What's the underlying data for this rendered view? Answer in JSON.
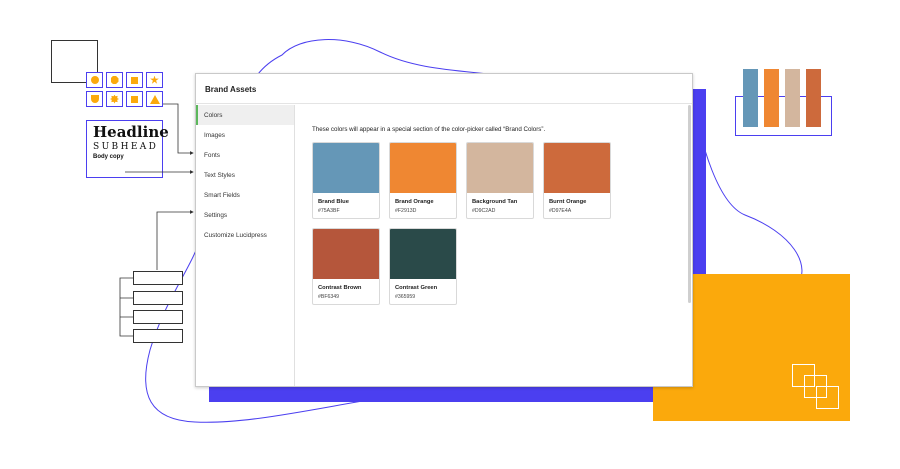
{
  "window": {
    "title": "Brand Assets"
  },
  "sidebar": {
    "items": [
      {
        "label": "Colors",
        "active": true
      },
      {
        "label": "Images",
        "active": false
      },
      {
        "label": "Fonts",
        "active": false
      },
      {
        "label": "Text Styles",
        "active": false
      },
      {
        "label": "Smart Fields",
        "active": false
      },
      {
        "label": "Settings",
        "active": false
      },
      {
        "label": "Customize Lucidpress",
        "active": false
      }
    ]
  },
  "content": {
    "note": "These colors will appear in a special section of the color-picker called “Brand Colors”.",
    "colors": [
      {
        "name": "Brand Blue",
        "hex": "#75A3BF",
        "color": "#6597b7"
      },
      {
        "name": "Brand Orange",
        "hex": "#F2913D",
        "color": "#ef8732"
      },
      {
        "name": "Background Tan",
        "hex": "#D9C2AD",
        "color": "#d3b69e"
      },
      {
        "name": "Burnt Orange",
        "hex": "#D97E4A",
        "color": "#cd6a3c"
      },
      {
        "name": "Contrast Brown",
        "hex": "#BF6349",
        "color": "#b5563b"
      },
      {
        "name": "Contrast Green",
        "hex": "#365959",
        "color": "#2a4a49"
      }
    ]
  },
  "decor": {
    "headline": "Headline",
    "subhead": "SUBHEAD",
    "body": "Body copy",
    "swatch_colors": [
      "#6597b7",
      "#ef8732",
      "#d3b69e",
      "#cd6a3c"
    ],
    "accent": "#4b3ff0",
    "highlight": "#fba90c"
  }
}
